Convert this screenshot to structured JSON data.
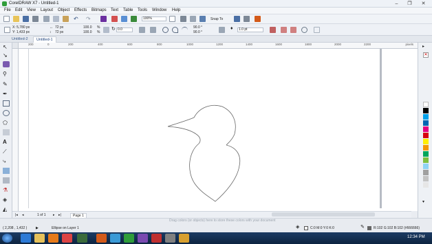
{
  "window": {
    "title": "CorelDRAW X7 - Untitled-1",
    "controls": [
      "–",
      "❐",
      "✕"
    ]
  },
  "menu": [
    "File",
    "Edit",
    "View",
    "Layout",
    "Object",
    "Effects",
    "Bitmaps",
    "Text",
    "Table",
    "Tools",
    "Window",
    "Help"
  ],
  "toolbar1": {
    "zoom": "100%",
    "snap_to": "Snap To"
  },
  "propertybar": {
    "x": "X: 5,780 px",
    "y": "Y: 1,433 px",
    "width": "72 px",
    "height": "72 px",
    "scale_x": "100.0",
    "scale_y": "100.0",
    "pct": "%",
    "rotation": "0.0",
    "angle_start": "90.0 °",
    "angle_end": "90.0 °",
    "outline_width": "1.0 pt"
  },
  "doc_tabs": [
    "Untitled-2",
    "Untitled-1"
  ],
  "ruler": {
    "h_ticks": [
      "200",
      "0",
      "200",
      "400",
      "600",
      "800",
      "1000",
      "1200",
      "1400",
      "1600",
      "1800",
      "2000",
      "2200"
    ],
    "units": "pixels"
  },
  "page_nav": {
    "counter": "1 of 1",
    "page_tab": "Page 1"
  },
  "drag_tip": "Drag colors (or objects) here to store these colors with your document",
  "status": {
    "coords": "( 2,208 , 1,432 )",
    "object_info": "Ellipse on Layer 1",
    "fill_info": "C:0 M:0 Y:0 K:0",
    "outline_info": "R:102 G:102 B:102 (#666666)"
  },
  "taskbar": {
    "time": "12:34 PM"
  },
  "colors": {
    "accent": "#2f9d3a",
    "palette": [
      "#ffffff",
      "#000000",
      "#00a0e9",
      "#0066b3",
      "#e4007f",
      "#d7000f",
      "#ffef00",
      "#f39800",
      "#00a65a",
      "#7fbf3f",
      "#8fd3f4",
      "#a0a0a0",
      "#c3c3c3",
      "#e6e6e6"
    ]
  }
}
